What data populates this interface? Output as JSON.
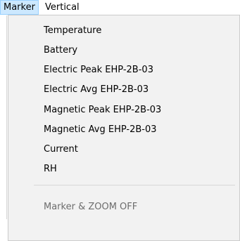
{
  "menubar": {
    "items": [
      {
        "label": "Marker",
        "active": true
      },
      {
        "label": "Vertical",
        "active": false
      }
    ]
  },
  "dropdown": {
    "items": [
      {
        "label": "Temperature",
        "enabled": true
      },
      {
        "label": "Battery",
        "enabled": true
      },
      {
        "label": "Electric Peak EHP-2B-03",
        "enabled": true
      },
      {
        "label": "Electric Avg EHP-2B-03",
        "enabled": true
      },
      {
        "label": "Magnetic Peak EHP-2B-03",
        "enabled": true
      },
      {
        "label": "Magnetic Avg EHP-2B-03",
        "enabled": true
      },
      {
        "label": "Current",
        "enabled": true
      },
      {
        "label": "RH",
        "enabled": true
      },
      {
        "label": "Marker & ZOOM OFF",
        "enabled": false
      }
    ]
  },
  "colors": {
    "menu_background": "#f2f2f2",
    "active_highlight": "#cce8ff",
    "active_border": "#99d1ff",
    "disabled_text": "#6d6d6d"
  }
}
